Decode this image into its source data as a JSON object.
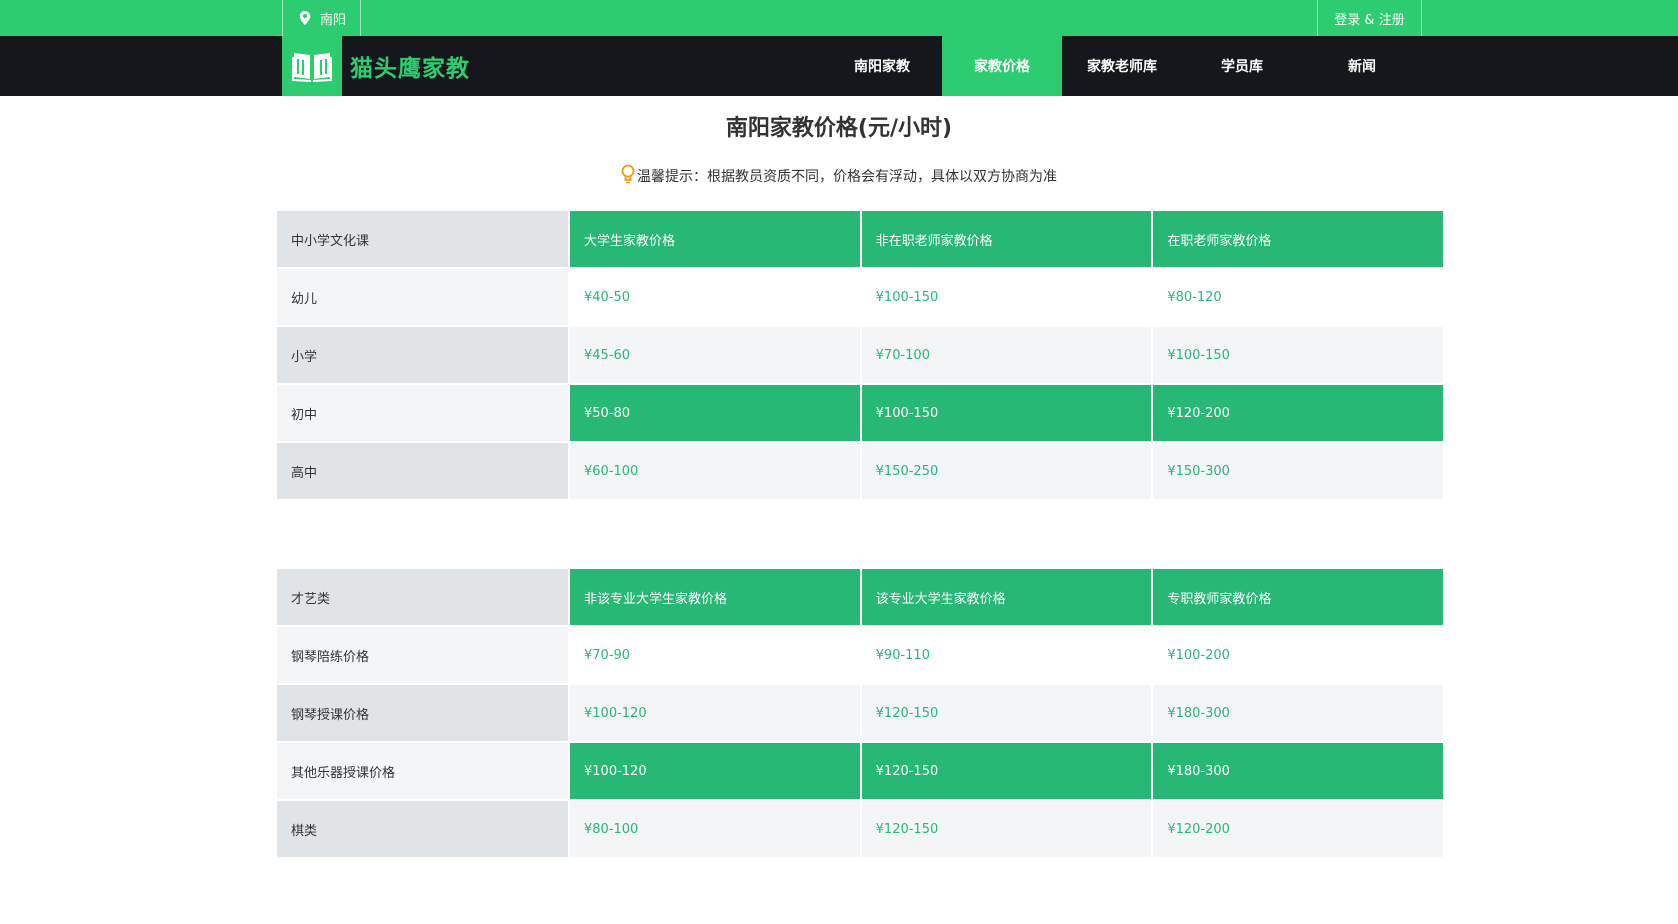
{
  "topbar": {
    "city": "南阳",
    "login": "登录 & 注册"
  },
  "brand": {
    "name": "猫头鹰家教"
  },
  "nav": [
    {
      "label": "南阳家教",
      "active": false
    },
    {
      "label": "家教价格",
      "active": true
    },
    {
      "label": "家教老师库",
      "active": false
    },
    {
      "label": "学员库",
      "active": false
    },
    {
      "label": "新闻",
      "active": false
    }
  ],
  "page": {
    "title": "南阳家教价格(元/小时)",
    "hint": "温馨提示：根据教员资质不同，价格会有浮动，具体以双方协商为准"
  },
  "tables": [
    {
      "header": [
        "中小学文化课",
        "大学生家教价格",
        "非在职老师家教价格",
        "在职老师家教价格"
      ],
      "rows": [
        [
          "幼儿",
          "¥40-50",
          "¥100-150",
          "¥80-120"
        ],
        [
          "小学",
          "¥45-60",
          "¥70-100",
          "¥100-150"
        ],
        [
          "初中",
          "¥50-80",
          "¥100-150",
          "¥120-200"
        ],
        [
          "高中",
          "¥60-100",
          "¥150-250",
          "¥150-300"
        ]
      ]
    },
    {
      "header": [
        "才艺类",
        "非该专业大学生家教价格",
        "该专业大学生家教价格",
        "专职教师家教价格"
      ],
      "rows": [
        [
          "钢琴陪练价格",
          "¥70-90",
          "¥90-110",
          "¥100-200"
        ],
        [
          "钢琴授课价格",
          "¥100-120",
          "¥120-150",
          "¥180-300"
        ],
        [
          "其他乐器授课价格",
          "¥100-120",
          "¥120-150",
          "¥180-300"
        ],
        [
          "棋类",
          "¥80-100",
          "¥120-150",
          "¥120-200"
        ]
      ]
    }
  ],
  "colors": {
    "brand_green": "#2ecc71",
    "table_green": "#27b876",
    "nav_dark": "#15171c"
  }
}
